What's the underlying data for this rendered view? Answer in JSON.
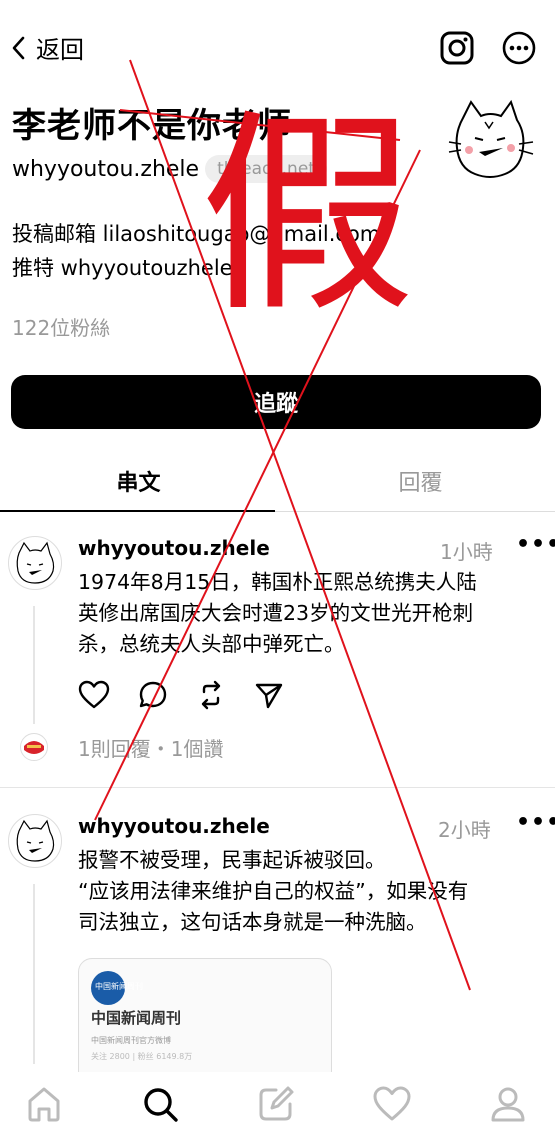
{
  "topbar": {
    "back_label": "返回",
    "back_icon": "chevron-left-icon",
    "icons": [
      "instagram-icon",
      "more-circle-icon"
    ]
  },
  "profile": {
    "name": "李老师不是你老师",
    "handle": "whyyoutou.zhele",
    "domain_badge": "threads.net",
    "bio_line1": "投稿邮箱 lilaoshitougao@gmail.com",
    "bio_line2": "推特 whyyoutouzhele",
    "followers": "122位粉絲"
  },
  "follow_button": "追蹤",
  "tabs": {
    "threads": "串文",
    "replies": "回覆"
  },
  "posts": [
    {
      "user": "whyyoutou.zhele",
      "time": "1小時",
      "text_lines": [
        "1974年8月15日，韩国朴正熙总统携夫人陆",
        "英修出席国庆大会时遭23岁的文世光开枪刺",
        "杀，总统夫人头部中弹死亡。"
      ],
      "meta": "1則回覆・1個讚"
    },
    {
      "user": "whyyoutou.zhele",
      "time": "2小時",
      "text_lines": [
        "报警不被受理，民事起诉被驳回。",
        "“应该用法律来维护自己的权益”，如果没有",
        "司法独立，这句话本身就是一种洗脑。"
      ],
      "card": {
        "logo_text": "中国新闻周刊",
        "title": "中国新闻周刊",
        "subtitle": "中国新闻周刊官方微博",
        "stats": "关注 2800 | 粉丝 6149.8万"
      }
    }
  ],
  "overlay_mark": "假",
  "colors": {
    "accent": "#000000",
    "muted": "#999999",
    "overlay_red": "#e0121c"
  }
}
